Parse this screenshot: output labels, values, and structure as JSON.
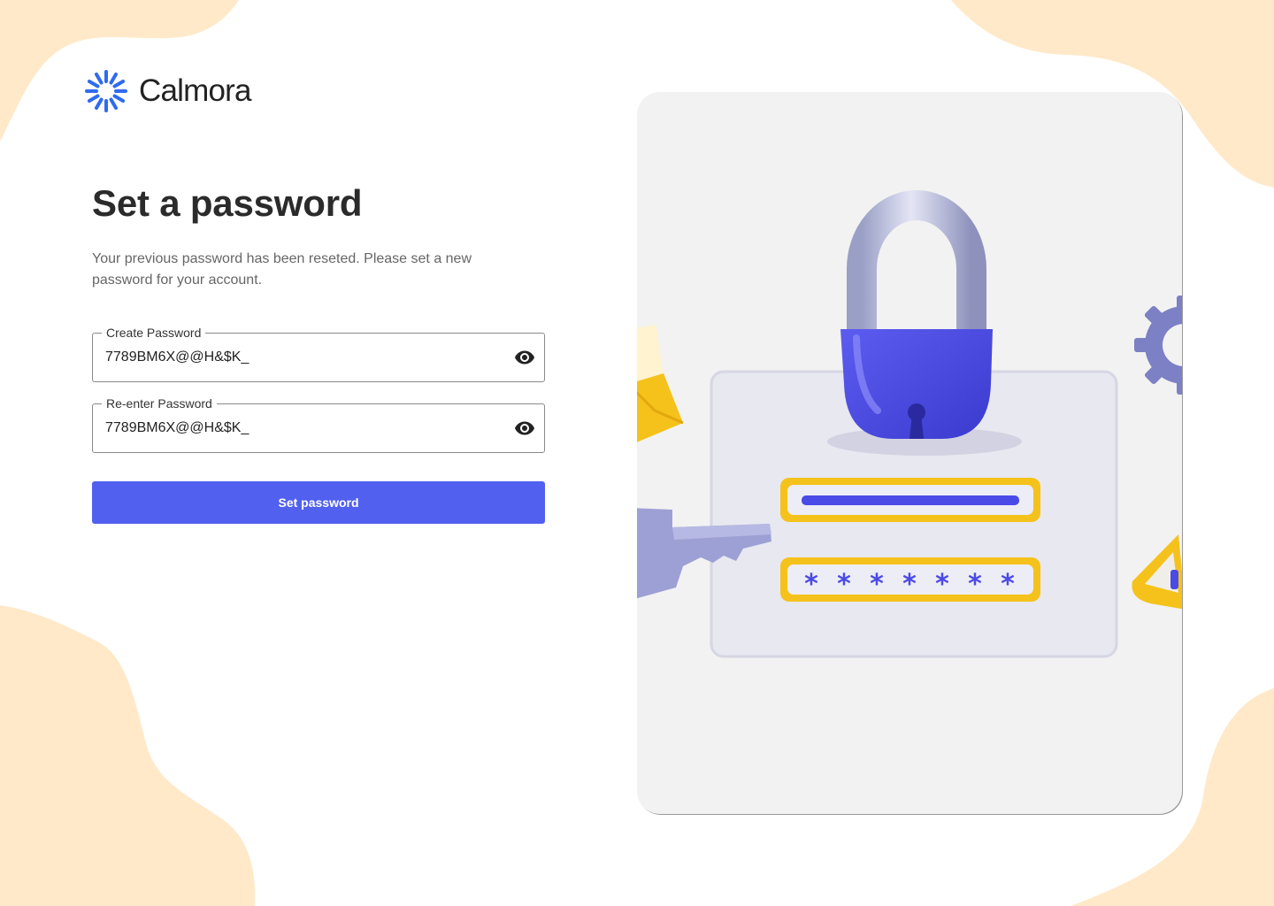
{
  "brand": {
    "name": "Calmora",
    "logo_color": "#2F6BF0"
  },
  "heading": "Set a password",
  "subtitle": "Your previous password has been reseted. Please set a new password for your account.",
  "fields": [
    {
      "label": "Create Password",
      "value": "7789BM6X@@H&$K_",
      "icon": "eye-icon"
    },
    {
      "label": "Re-enter Password",
      "value": "7789BM6X@@H&$K_",
      "icon": "eye-icon"
    }
  ],
  "submit_label": "Set password",
  "colors": {
    "primary": "#5160EE",
    "background_blob": "#FFE9C9",
    "panel": "#F2F2F2",
    "lock_body": "#4E4EE3",
    "accent_yellow": "#F5C21B"
  }
}
